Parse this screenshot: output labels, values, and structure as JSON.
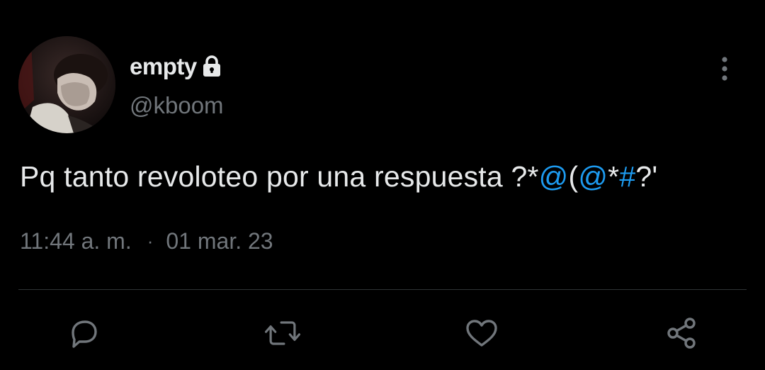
{
  "author": {
    "display_name": "empty",
    "handle": "@kboom",
    "protected": true,
    "lock_icon": "lock-icon",
    "avatar_icon": "profile-photo"
  },
  "tweet": {
    "text_plain": "Pq tanto revoloteo por una respuesta ?*",
    "mention_1": "@",
    "text_mid": "(",
    "mention_2": "@",
    "text_mid2": "*",
    "hashtag": "#",
    "text_end": "?'"
  },
  "meta": {
    "time": "11:44 a. m.",
    "separator": "·",
    "date": "01 mar. 23"
  },
  "actions": {
    "reply_icon": "reply-icon",
    "retweet_icon": "retweet-icon",
    "like_icon": "heart-icon",
    "share_icon": "share-icon"
  },
  "menu": {
    "more_icon": "more-vertical-icon"
  },
  "colors": {
    "background": "#000000",
    "text_primary": "#e7e9ea",
    "text_secondary": "#71767b",
    "accent": "#1d9bf0",
    "divider": "#2f3336"
  }
}
